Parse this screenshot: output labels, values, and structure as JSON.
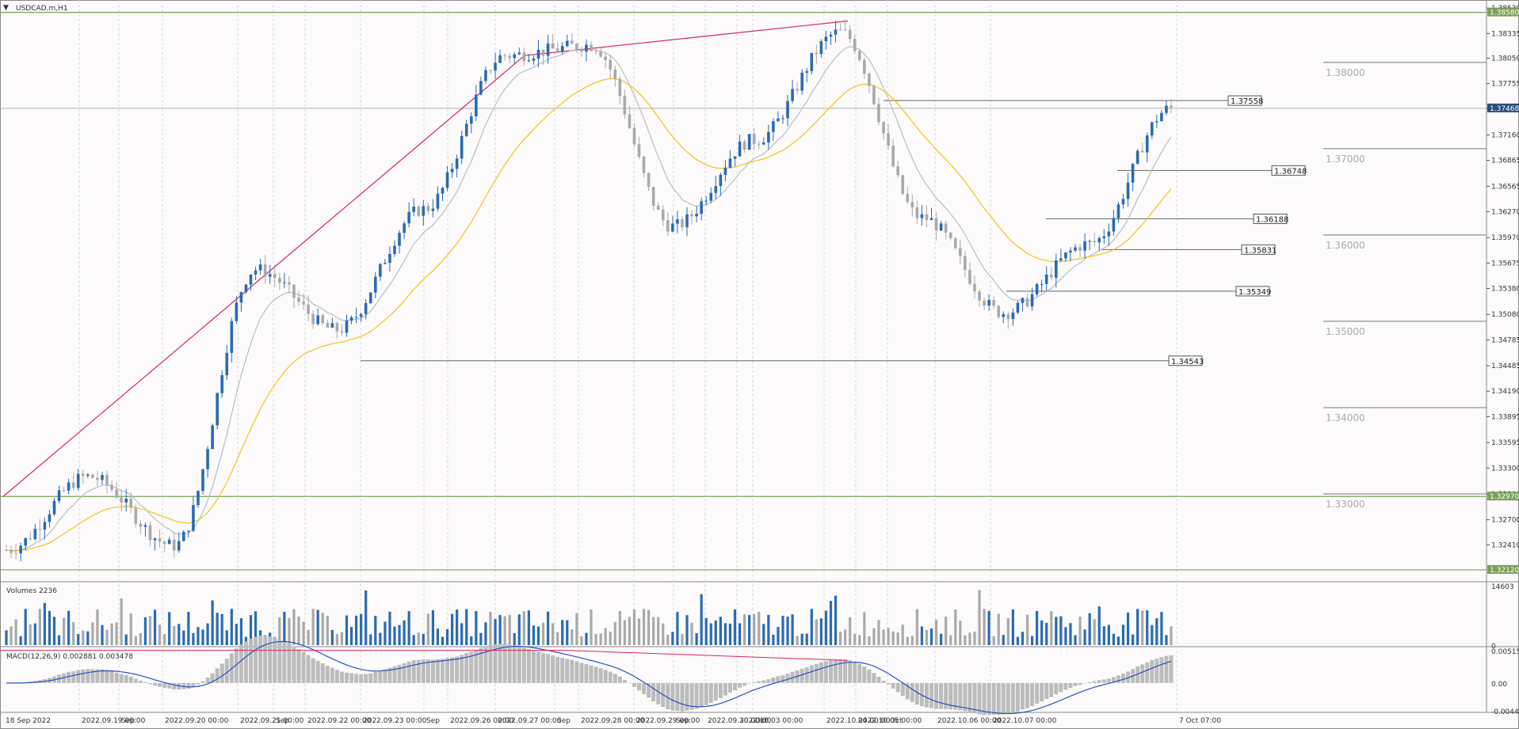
{
  "window": {
    "symbol_title": "USDCAD.m,H1"
  },
  "colors": {
    "bull": "#2a6bb0",
    "bear": "#a9a9a9",
    "ema_fast": "#b7bec6",
    "ema_slow": "#f0c419",
    "trend": "#d7265f",
    "hline": "#7ba05b"
  },
  "chart_data": [
    {
      "type": "candlestick",
      "panel": "price",
      "ylim": [
        1.32,
        1.3865
      ],
      "y_ticks": [
        "1.38630",
        "1.38335",
        "1.38050",
        "1.37755",
        "1.37468",
        "1.37160",
        "1.36865",
        "1.36565",
        "1.36270",
        "1.35970",
        "1.35675",
        "1.35380",
        "1.35080",
        "1.34785",
        "1.34485",
        "1.34190",
        "1.33895",
        "1.33595",
        "1.33300",
        "1.33000",
        "1.32700",
        "1.32410"
      ],
      "current_price": "1.37468",
      "horizontal_levels": [
        {
          "label": "1.38580",
          "value": 1.3858
        },
        {
          "label": "1.32970",
          "value": 1.3297
        },
        {
          "label": "1.32120",
          "value": 1.3212
        }
      ],
      "round_levels": [
        {
          "label": "1.38000",
          "value": 1.38
        },
        {
          "label": "1.37000",
          "value": 1.37
        },
        {
          "label": "1.36000",
          "value": 1.36
        },
        {
          "label": "1.35000",
          "value": 1.35
        },
        {
          "label": "1.34000",
          "value": 1.34
        },
        {
          "label": "1.33000",
          "value": 1.33
        }
      ],
      "support_resistance": [
        {
          "label": "1.37558",
          "value": 1.37558
        },
        {
          "label": "1.36748",
          "value": 1.36748
        },
        {
          "label": "1.36188",
          "value": 1.36188
        },
        {
          "label": "1.35831",
          "value": 1.35831
        },
        {
          "label": "1.35349",
          "value": 1.35349
        },
        {
          "label": "1.34543",
          "value": 1.34543
        }
      ],
      "x_ticks": [
        "18 Sep 2022",
        "2022.09.19 00:00",
        "Sep",
        "2022.09.20 00:00",
        "2022.09.21 00:00",
        "Sep",
        "2022.09.22 00:00",
        "2022.09.23 00:00",
        "Sep",
        "2022.09.26 00:00",
        "2022.09.27 00:00",
        "Sep",
        "2022.09.28 00:00",
        "2022.09.29 00:00",
        "Sep",
        "2022.09.30 00:00",
        "2022.10.03 00:00",
        "Oct",
        "2022.10.04 00:00",
        "2022.10.05 00:00",
        "Oct",
        "2022.10.06 00:00",
        "2022.10.07 00:00",
        "7 Oct 07:00"
      ],
      "key_points": [
        {
          "x": "2022.09.19",
          "close": 1.3235
        },
        {
          "x": "2022.09.20",
          "close": 1.332
        },
        {
          "x": "2022.09.21",
          "close": 1.324
        },
        {
          "x": "2022.09.22",
          "close": 1.356
        },
        {
          "x": "2022.09.23",
          "close": 1.349
        },
        {
          "x": "2022.09.26",
          "close": 1.363
        },
        {
          "x": "2022.09.27",
          "close": 1.3808
        },
        {
          "x": "2022.09.28",
          "close": 1.382
        },
        {
          "x": "2022.09.29",
          "close": 1.361
        },
        {
          "x": "2022.09.30",
          "close": 1.371
        },
        {
          "x": "2022.10.03",
          "close": 1.3835
        },
        {
          "x": "2022.10.04",
          "close": 1.362
        },
        {
          "x": "2022.10.05",
          "close": 1.351
        },
        {
          "x": "2022.10.06",
          "close": 1.359
        },
        {
          "x": "2022.10.07",
          "close": 1.3747
        }
      ]
    },
    {
      "type": "bar",
      "panel": "volume",
      "title": "Volumes 2236",
      "ylim": [
        0,
        14603
      ],
      "y_ticks": [
        "14603",
        "0"
      ]
    },
    {
      "type": "bar",
      "panel": "macd",
      "title": "MACD(12,26,9) 0.002881 0.003478",
      "ylim": [
        -0.00444,
        0.005157
      ],
      "y_ticks": [
        "0.005157",
        "0.00",
        "-0.004446"
      ]
    }
  ]
}
